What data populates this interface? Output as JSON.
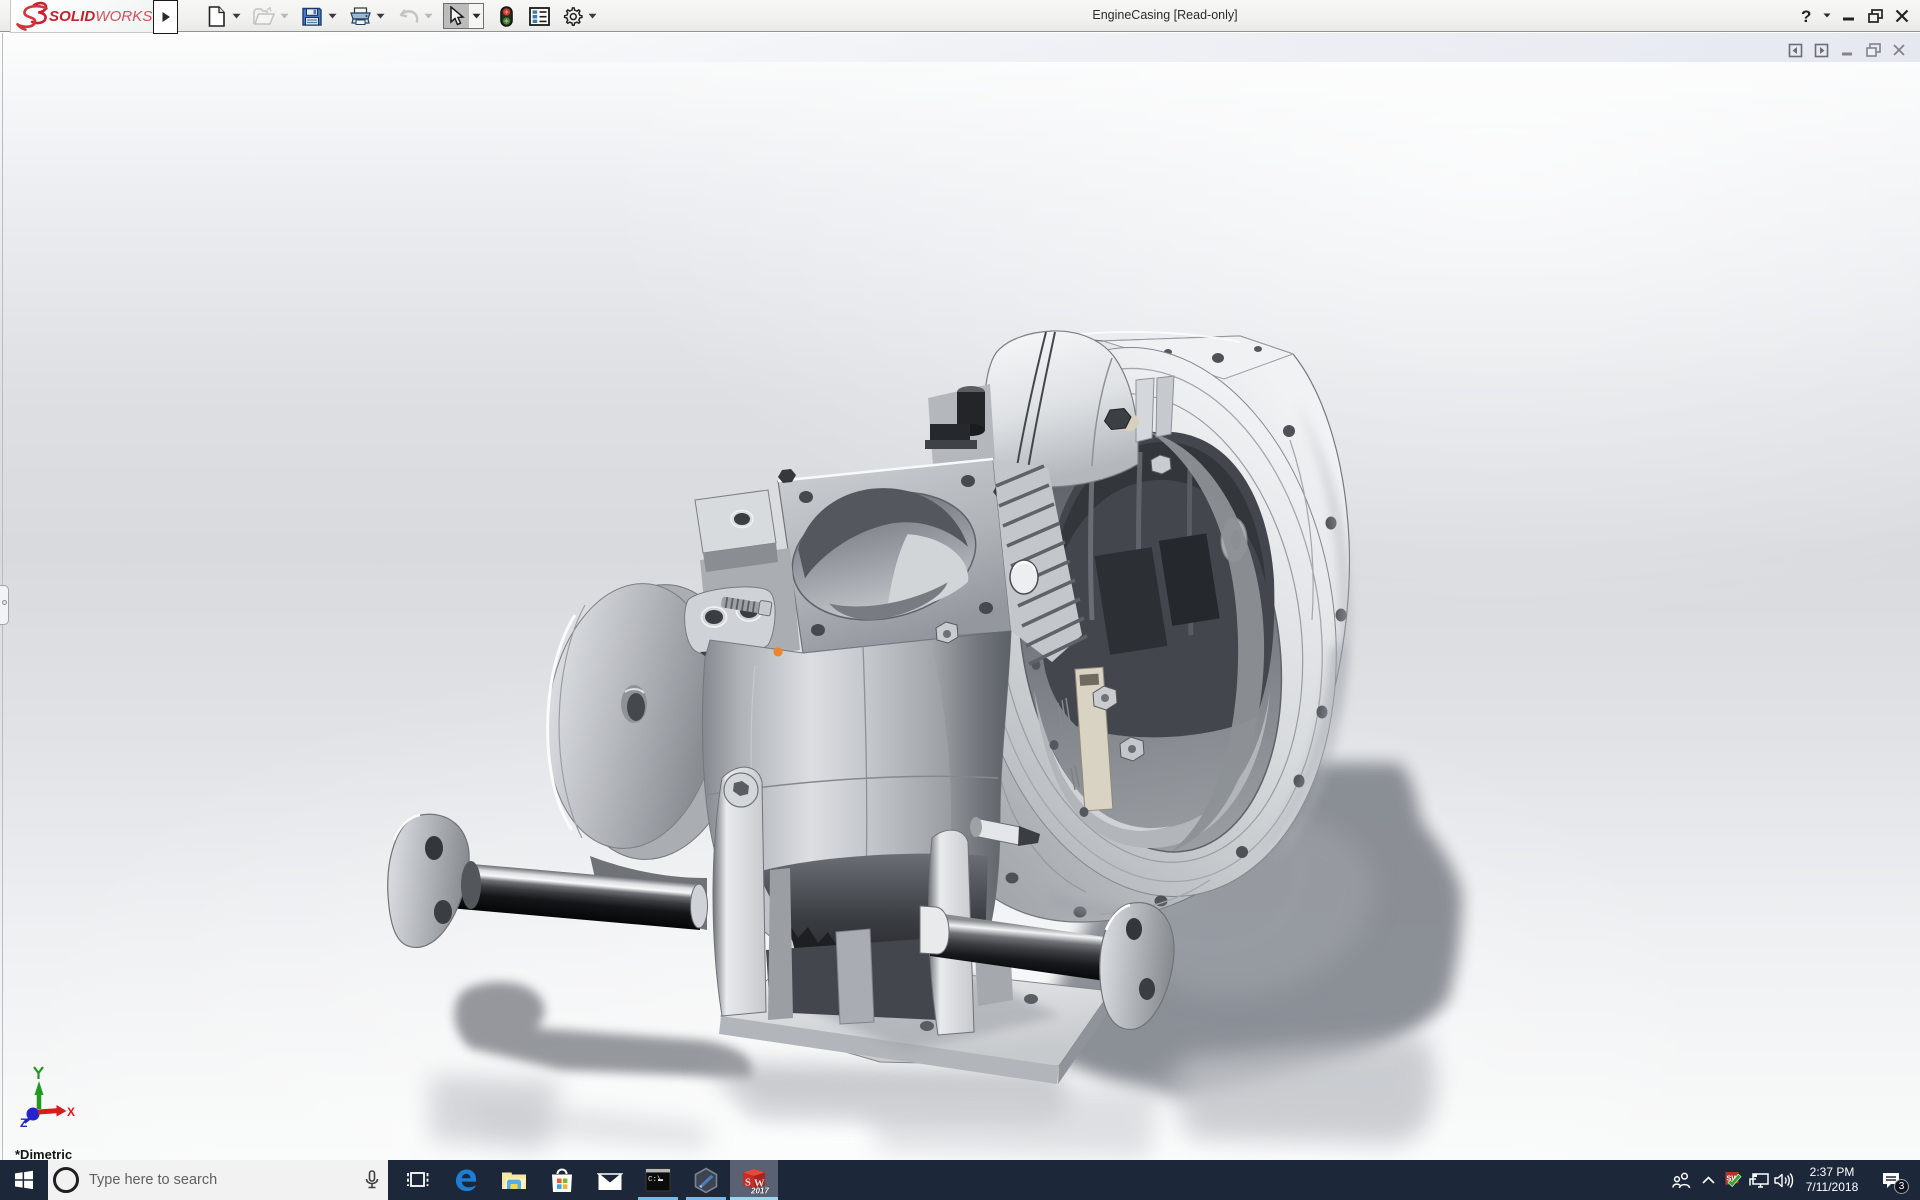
{
  "titlebar": {
    "brand": {
      "solid": "SOLID",
      "works": "WORKS"
    },
    "title": "EngineCasing [Read-only]",
    "tools": [
      {
        "id": "new",
        "label": "New"
      },
      {
        "id": "open",
        "label": "Open"
      },
      {
        "id": "save",
        "label": "Save"
      },
      {
        "id": "print",
        "label": "Print"
      },
      {
        "id": "undo",
        "label": "Undo"
      },
      {
        "id": "select",
        "label": "Select"
      },
      {
        "id": "xpress",
        "label": "Xpress Products"
      },
      {
        "id": "options-list",
        "label": "Options"
      },
      {
        "id": "settings",
        "label": "Settings"
      }
    ],
    "help_glyph": "?"
  },
  "viewport": {
    "view_label": "*Dimetric",
    "triad": {
      "x": "X",
      "y": "Y",
      "z": "Z"
    },
    "marker_color": "#f0822a",
    "background_top": "#fdfdfd",
    "background_mid": "#d8dade",
    "background_bottom": "#f9fafa"
  },
  "taskbar": {
    "search": {
      "placeholder": "Type here to search"
    },
    "apps": [
      {
        "id": "task-view",
        "running": false
      },
      {
        "id": "edge",
        "running": false
      },
      {
        "id": "file-explorer",
        "running": false
      },
      {
        "id": "store",
        "running": false
      },
      {
        "id": "mail",
        "running": false
      },
      {
        "id": "command-prompt",
        "running": true,
        "glyph": "C:\\"
      },
      {
        "id": "edrawings",
        "running": true
      },
      {
        "id": "solidworks-2017",
        "running": true,
        "active": true,
        "letters": [
          "S",
          "W"
        ],
        "year": "2017"
      }
    ],
    "tray": {
      "time": "2:37 PM",
      "date": "7/11/2018",
      "notification_count": "3",
      "sw_label": "SW"
    },
    "colors": {
      "bar": "#1b2639",
      "underline": "#76b9ed",
      "active_slot": "#5a6172"
    }
  }
}
